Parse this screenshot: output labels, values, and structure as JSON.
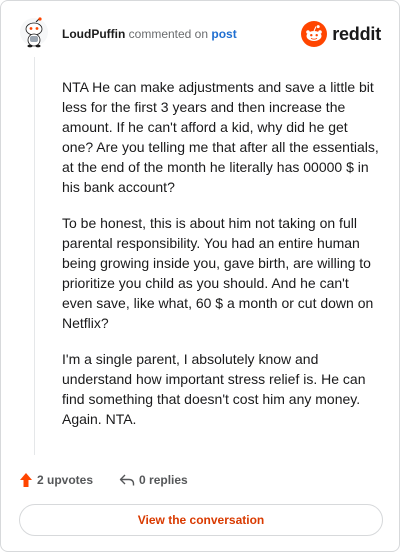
{
  "header": {
    "username": "LoudPuffin",
    "action_text": "commented on",
    "post_link": "post",
    "brand": "reddit"
  },
  "comment": {
    "paragraphs": [
      "NTA He can make adjustments and save a little bit less for the first 3 years and then increase the amount. If he can't afford a kid, why did he get one? Are you telling me that after all the essentials, at the end of the month he literally has 00000 $ in his bank account?",
      "To be honest, this is about him not taking on full parental responsibility. You had an entire human being growing inside you, gave birth, are willing to prioritize you child as you should. And he can't even save, like what, 60 $ a month or cut down on Netflix?",
      "I'm a single parent, I absolutely know and understand how important stress relief is. He can find something that doesn't cost him any money. Again. NTA."
    ]
  },
  "footer": {
    "upvotes_label": "2 upvotes",
    "replies_label": "0 replies",
    "cta_label": "View the conversation"
  },
  "colors": {
    "brand_orange": "#ff4500",
    "cta_text": "#d93a00",
    "link_blue": "#1f6fd1"
  },
  "icons": [
    "avatar-snoo",
    "reddit-logo-icon",
    "upvote-arrow-icon",
    "reply-arrow-icon"
  ]
}
